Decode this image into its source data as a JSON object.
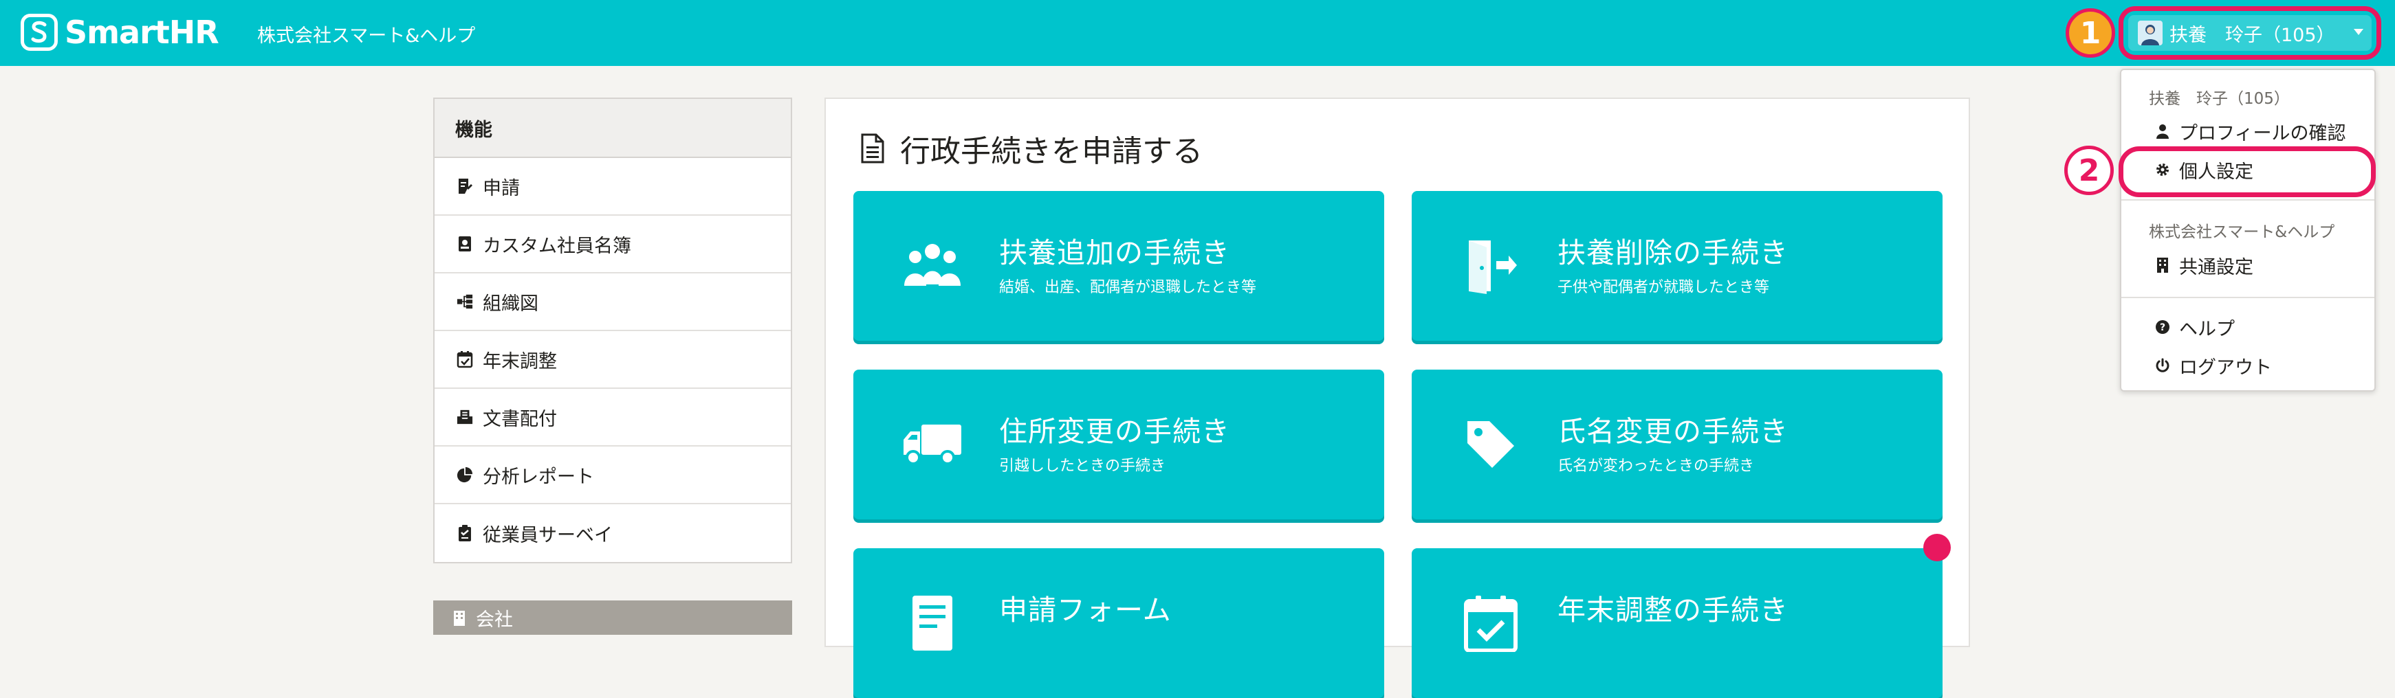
{
  "header": {
    "brand": "SmartHR",
    "company": "株式会社スマート&ヘルプ",
    "user_label": "扶養　玲子（105）"
  },
  "annotations": {
    "step1": "1",
    "step2": "2"
  },
  "sidebar": {
    "heading": "機能",
    "items": [
      {
        "label": "申請",
        "icon": "request-icon"
      },
      {
        "label": "カスタム社員名簿",
        "icon": "roster-icon"
      },
      {
        "label": "組織図",
        "icon": "org-chart-icon"
      },
      {
        "label": "年末調整",
        "icon": "calendar-check-icon"
      },
      {
        "label": "文書配付",
        "icon": "document-tray-icon"
      },
      {
        "label": "分析レポート",
        "icon": "pie-chart-icon"
      },
      {
        "label": "従業員サーベイ",
        "icon": "clipboard-icon"
      }
    ],
    "company_label": "会社"
  },
  "main": {
    "title": "行政手続きを申請する",
    "cards": [
      {
        "title": "扶養追加の手続き",
        "subtitle": "結婚、出産、配偶者が退職したとき等",
        "icon": "family-icon"
      },
      {
        "title": "扶養削除の手続き",
        "subtitle": "子供や配偶者が就職したとき等",
        "icon": "exit-door-icon"
      },
      {
        "title": "住所変更の手続き",
        "subtitle": "引越ししたときの手続き",
        "icon": "truck-icon"
      },
      {
        "title": "氏名変更の手続き",
        "subtitle": "氏名が変わったときの手続き",
        "icon": "tag-icon"
      },
      {
        "title": "申請フォーム",
        "subtitle": "",
        "icon": "form-icon"
      },
      {
        "title": "年末調整の手続き",
        "subtitle": "",
        "icon": "calendar-check-icon"
      }
    ]
  },
  "dropdown": {
    "user_caption": "扶養　玲子（105）",
    "profile": "プロフィールの確認",
    "personal_settings": "個人設定",
    "company_caption": "株式会社スマート&ヘルプ",
    "common_settings": "共通設定",
    "help": "ヘルプ",
    "logout": "ログアウト"
  },
  "colors": {
    "brand": "#00c4cc",
    "highlight": "#e8185f"
  }
}
